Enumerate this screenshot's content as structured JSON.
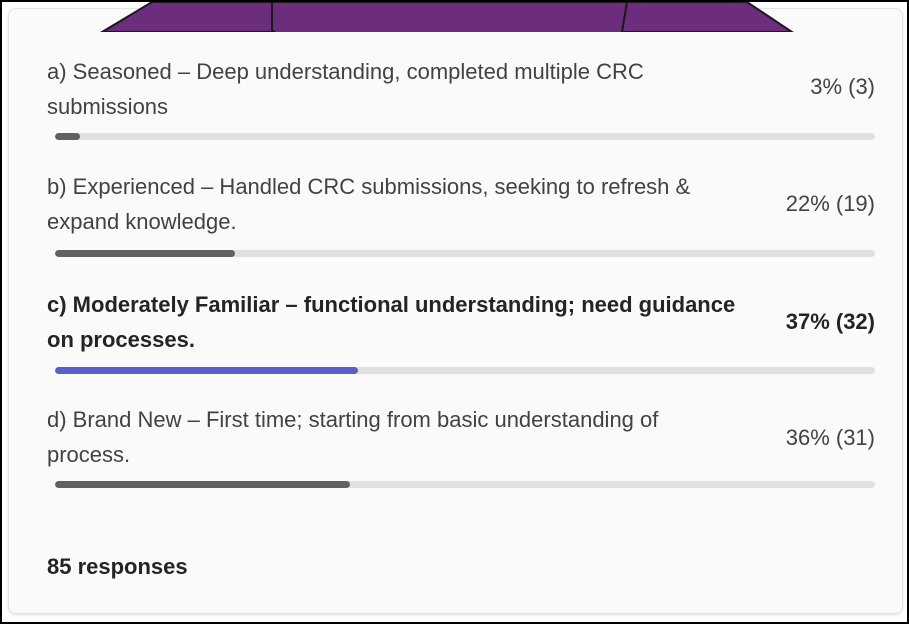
{
  "poll": {
    "options": [
      {
        "label": "a) Seasoned – Deep understanding, completed multiple CRC submissions",
        "result": "3% (3)",
        "percent": 3,
        "count": 3,
        "selected": false
      },
      {
        "label": "b) Experienced – Handled CRC submissions, seeking to refresh & expand knowledge.",
        "result": "22% (19)",
        "percent": 22,
        "count": 19,
        "selected": false
      },
      {
        "label": "c) Moderately Familiar – functional understanding; need guidance on processes.",
        "result": "37% (32)",
        "percent": 37,
        "count": 32,
        "selected": true
      },
      {
        "label": "d) Brand New – First time; starting from basic understanding of process.",
        "result": "36% (31)",
        "percent": 36,
        "count": 31,
        "selected": false
      }
    ],
    "responses": "85 responses"
  },
  "colors": {
    "banner": "#6b2d7c",
    "bar_default": "#616161",
    "bar_selected": "#5b5fc7",
    "track": "#e0e0e0",
    "card_background": "#fafafa"
  }
}
